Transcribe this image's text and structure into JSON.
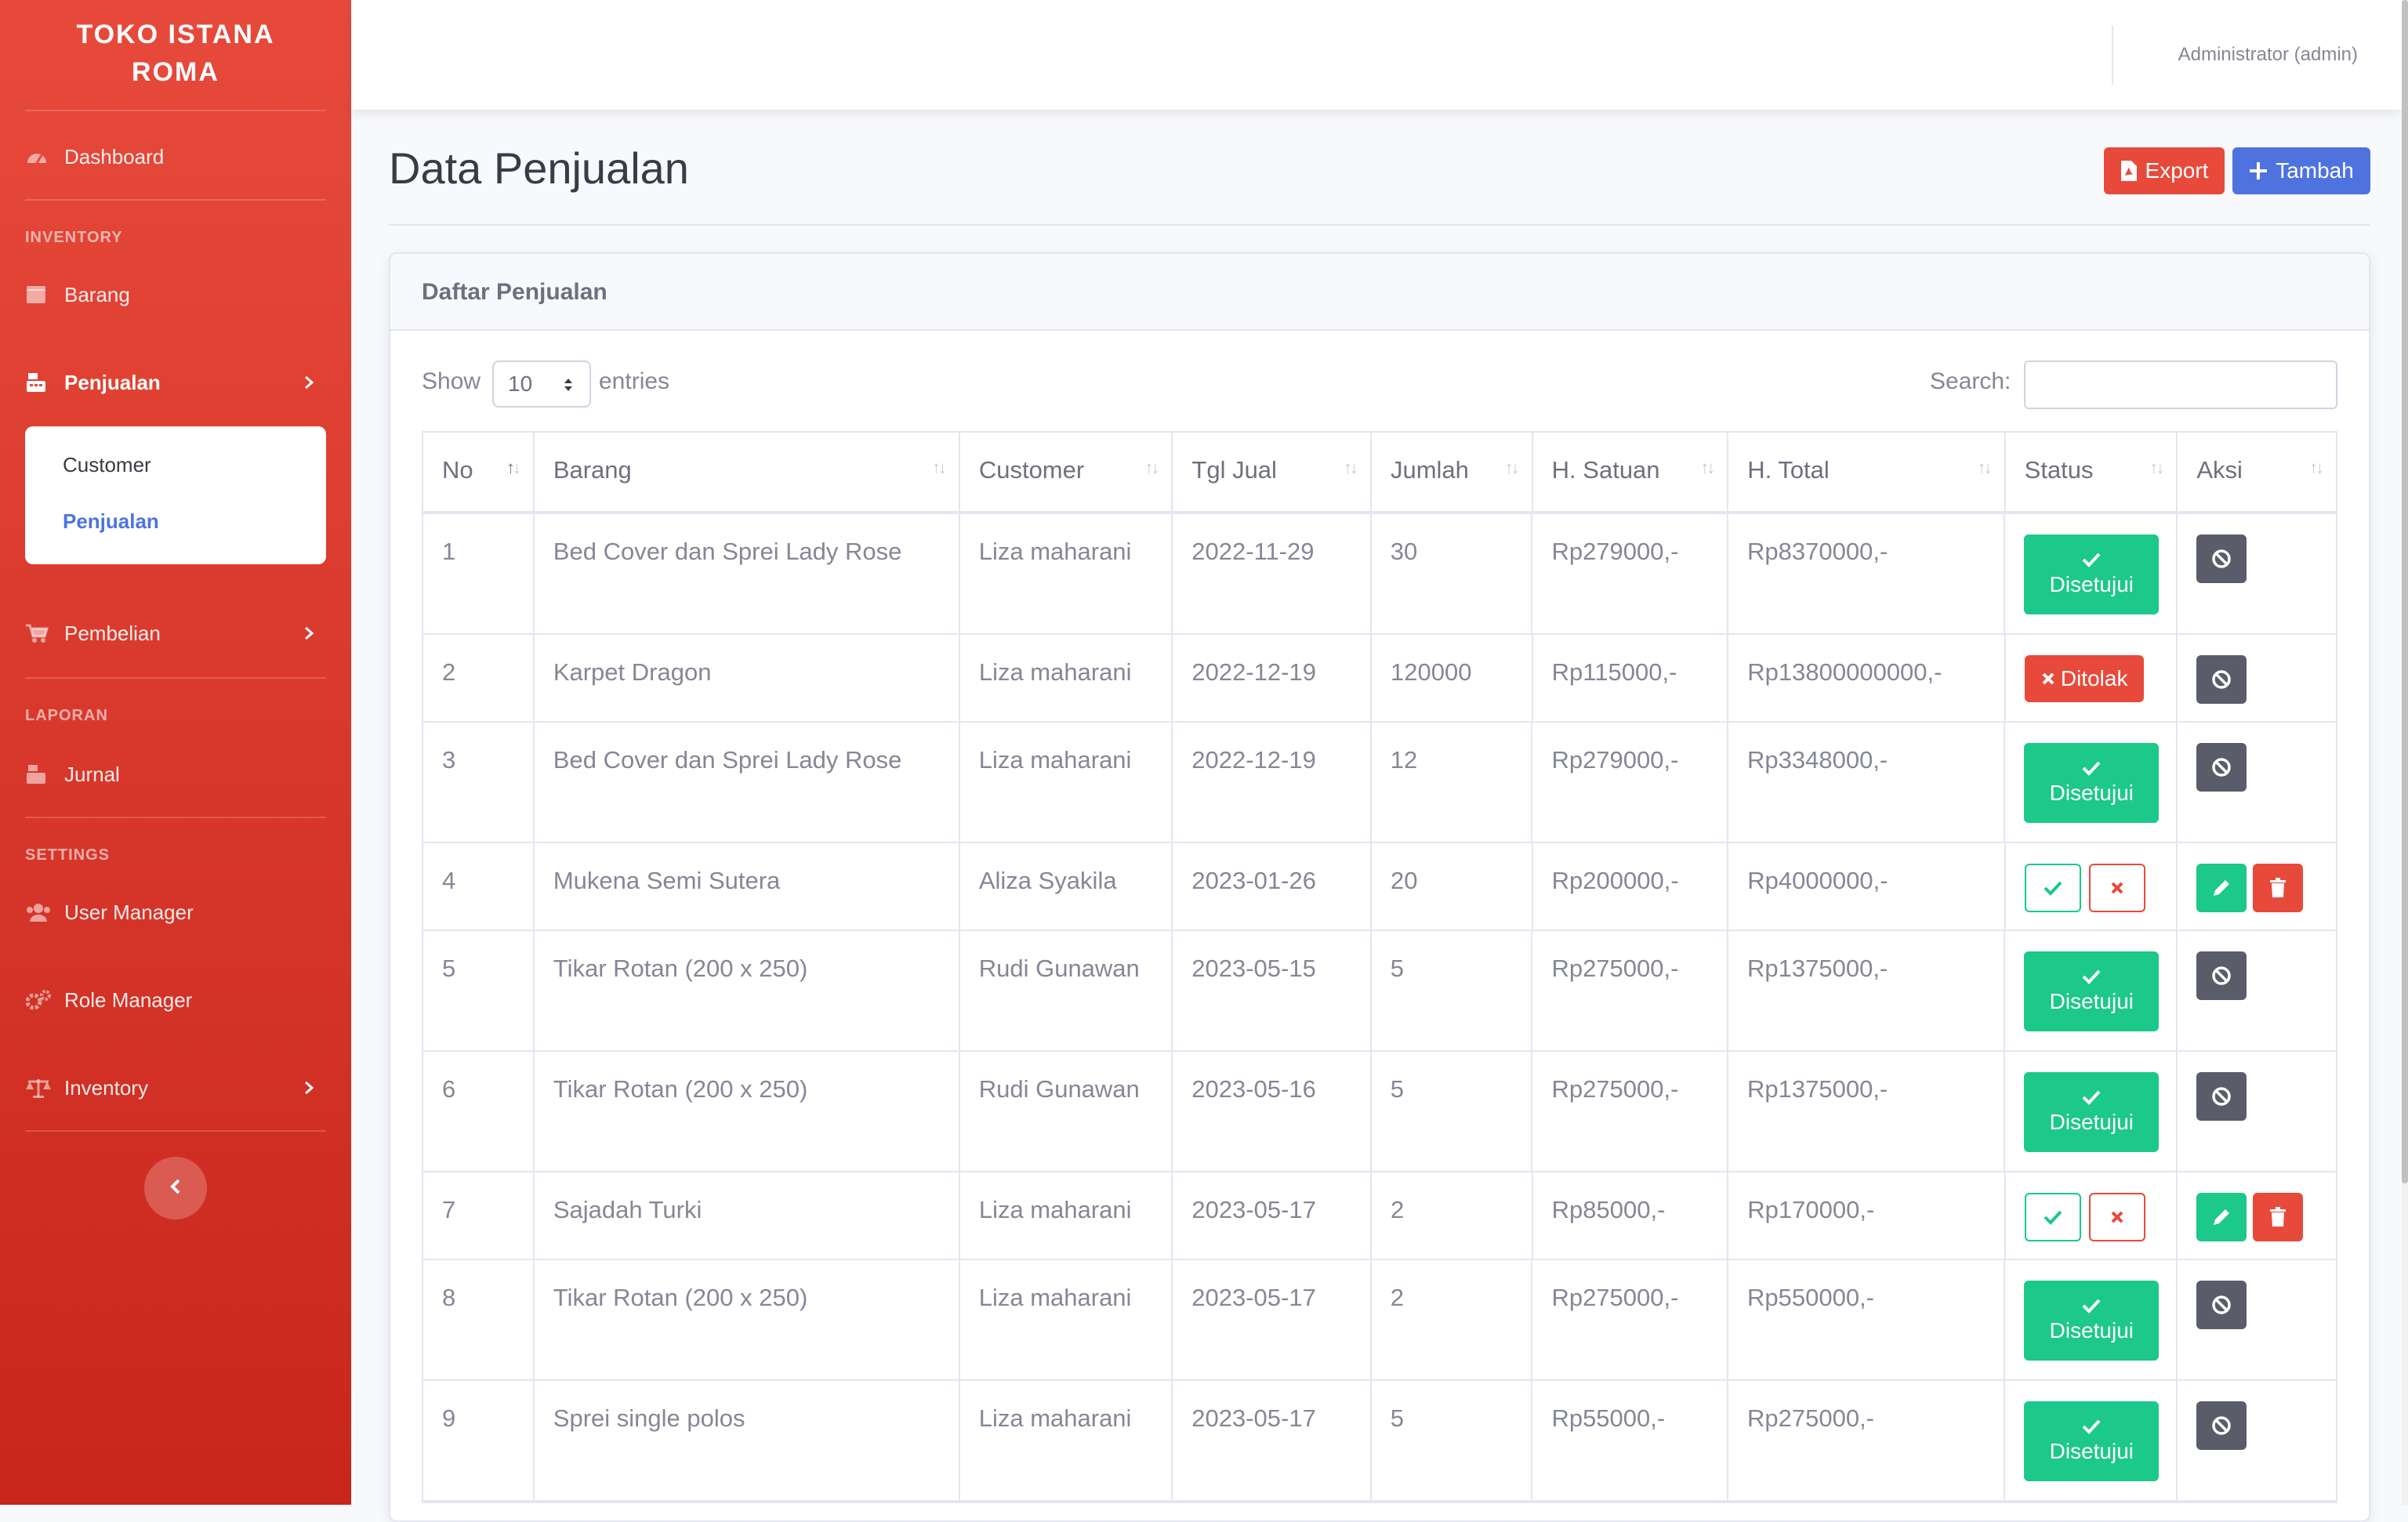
{
  "brand": {
    "line1": "TOKO ISTANA",
    "line2": "ROMA"
  },
  "sidebar": {
    "dashboard": "Dashboard",
    "heading_inventory": "INVENTORY",
    "barang": "Barang",
    "penjualan": "Penjualan",
    "submenu": {
      "customer": "Customer",
      "penjualan": "Penjualan"
    },
    "pembelian": "Pembelian",
    "heading_laporan": "LAPORAN",
    "jurnal": "Jurnal",
    "heading_settings": "SETTINGS",
    "user_manager": "User Manager",
    "role_manager": "Role Manager",
    "inventory": "Inventory"
  },
  "topbar": {
    "user": "Administrator (admin)"
  },
  "page": {
    "title": "Data Penjualan",
    "export_label": "Export",
    "add_label": "Tambah"
  },
  "card": {
    "title": "Daftar Penjualan"
  },
  "controls": {
    "show_label": "Show",
    "entries_value": "10",
    "entries_label": "entries",
    "search_label": "Search:",
    "search_value": ""
  },
  "table": {
    "headers": [
      "No",
      "Barang",
      "Customer",
      "Tgl Jual",
      "Jumlah",
      "H. Satuan",
      "H. Total",
      "Status",
      "Aksi"
    ],
    "status_labels": {
      "approved": "Disetujui",
      "rejected": "Ditolak"
    },
    "rows": [
      {
        "no": "1",
        "barang": "Bed Cover dan Sprei Lady Rose",
        "customer": "Liza maharani",
        "tgl": "2022-11-29",
        "jumlah": "30",
        "satuan": "Rp279000,-",
        "total": "Rp8370000,-",
        "status": "approved"
      },
      {
        "no": "2",
        "barang": "Karpet Dragon",
        "customer": "Liza maharani",
        "tgl": "2022-12-19",
        "jumlah": "120000",
        "satuan": "Rp115000,-",
        "total": "Rp13800000000,-",
        "status": "rejected"
      },
      {
        "no": "3",
        "barang": "Bed Cover dan Sprei Lady Rose",
        "customer": "Liza maharani",
        "tgl": "2022-12-19",
        "jumlah": "12",
        "satuan": "Rp279000,-",
        "total": "Rp3348000,-",
        "status": "approved"
      },
      {
        "no": "4",
        "barang": "Mukena Semi Sutera",
        "customer": "Aliza Syakila",
        "tgl": "2023-01-26",
        "jumlah": "20",
        "satuan": "Rp200000,-",
        "total": "Rp4000000,-",
        "status": "pending"
      },
      {
        "no": "5",
        "barang": "Tikar Rotan (200 x 250)",
        "customer": "Rudi Gunawan",
        "tgl": "2023-05-15",
        "jumlah": "5",
        "satuan": "Rp275000,-",
        "total": "Rp1375000,-",
        "status": "approved"
      },
      {
        "no": "6",
        "barang": "Tikar Rotan (200 x 250)",
        "customer": "Rudi Gunawan",
        "tgl": "2023-05-16",
        "jumlah": "5",
        "satuan": "Rp275000,-",
        "total": "Rp1375000,-",
        "status": "approved"
      },
      {
        "no": "7",
        "barang": "Sajadah Turki",
        "customer": "Liza maharani",
        "tgl": "2023-05-17",
        "jumlah": "2",
        "satuan": "Rp85000,-",
        "total": "Rp170000,-",
        "status": "pending"
      },
      {
        "no": "8",
        "barang": "Tikar Rotan (200 x 250)",
        "customer": "Liza maharani",
        "tgl": "2023-05-17",
        "jumlah": "2",
        "satuan": "Rp275000,-",
        "total": "Rp550000,-",
        "status": "approved"
      },
      {
        "no": "9",
        "barang": "Sprei single polos",
        "customer": "Liza maharani",
        "tgl": "2023-05-17",
        "jumlah": "5",
        "satuan": "Rp55000,-",
        "total": "Rp275000,-",
        "status": "approved"
      }
    ]
  },
  "colors": {
    "sidebar": "#e74a3b",
    "primary": "#4e73df",
    "success": "#1cc88a",
    "danger": "#e74a3b",
    "secondary": "#5a5c69"
  }
}
